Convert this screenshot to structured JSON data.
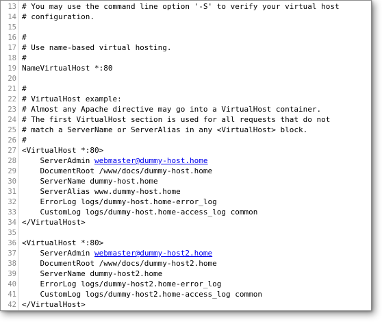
{
  "editor": {
    "lines": [
      {
        "num": "13",
        "pre": "# You may use the command line option '-S' to verify your virtual host",
        "link": "",
        "post": ""
      },
      {
        "num": "14",
        "pre": "# configuration.",
        "link": "",
        "post": ""
      },
      {
        "num": "15",
        "pre": "",
        "link": "",
        "post": ""
      },
      {
        "num": "16",
        "pre": "#",
        "link": "",
        "post": ""
      },
      {
        "num": "17",
        "pre": "# Use name-based virtual hosting.",
        "link": "",
        "post": ""
      },
      {
        "num": "18",
        "pre": "#",
        "link": "",
        "post": ""
      },
      {
        "num": "19",
        "pre": "NameVirtualHost *:80",
        "link": "",
        "post": ""
      },
      {
        "num": "20",
        "pre": "",
        "link": "",
        "post": ""
      },
      {
        "num": "21",
        "pre": "#",
        "link": "",
        "post": ""
      },
      {
        "num": "22",
        "pre": "# VirtualHost example:",
        "link": "",
        "post": ""
      },
      {
        "num": "23",
        "pre": "# Almost any Apache directive may go into a VirtualHost container.",
        "link": "",
        "post": ""
      },
      {
        "num": "24",
        "pre": "# The first VirtualHost section is used for all requests that do not",
        "link": "",
        "post": ""
      },
      {
        "num": "25",
        "pre": "# match a ServerName or ServerAlias in any <VirtualHost> block.",
        "link": "",
        "post": ""
      },
      {
        "num": "26",
        "pre": "#",
        "link": "",
        "post": ""
      },
      {
        "num": "27",
        "pre": "<VirtualHost *:80>",
        "link": "",
        "post": ""
      },
      {
        "num": "28",
        "pre": "    ServerAdmin ",
        "link": "webmaster@dummy-host.home",
        "post": ""
      },
      {
        "num": "29",
        "pre": "    DocumentRoot /www/docs/dummy-host.home",
        "link": "",
        "post": ""
      },
      {
        "num": "30",
        "pre": "    ServerName dummy-host.home",
        "link": "",
        "post": ""
      },
      {
        "num": "31",
        "pre": "    ServerAlias www.dummy-host.home",
        "link": "",
        "post": ""
      },
      {
        "num": "32",
        "pre": "    ErrorLog logs/dummy-host.home-error_log",
        "link": "",
        "post": ""
      },
      {
        "num": "33",
        "pre": "    CustomLog logs/dummy-host.home-access_log common",
        "link": "",
        "post": ""
      },
      {
        "num": "34",
        "pre": "</VirtualHost>",
        "link": "",
        "post": ""
      },
      {
        "num": "35",
        "pre": "",
        "link": "",
        "post": ""
      },
      {
        "num": "36",
        "pre": "<VirtualHost *:80>",
        "link": "",
        "post": ""
      },
      {
        "num": "37",
        "pre": "    ServerAdmin ",
        "link": "webmaster@dummy-host2.home",
        "post": ""
      },
      {
        "num": "38",
        "pre": "    DocumentRoot /www/docs/dummy-host2.home",
        "link": "",
        "post": ""
      },
      {
        "num": "39",
        "pre": "    ServerName dummy-host2.home",
        "link": "",
        "post": ""
      },
      {
        "num": "40",
        "pre": "    ErrorLog logs/dummy-host2.home-error_log",
        "link": "",
        "post": ""
      },
      {
        "num": "41",
        "pre": "    CustomLog logs/dummy-host2.home-access_log common",
        "link": "",
        "post": ""
      },
      {
        "num": "42",
        "pre": "</VirtualHost>",
        "link": "",
        "post": ""
      }
    ]
  },
  "colors": {
    "link": "#0000ee",
    "line_number": "#8a8a8a",
    "text": "#000000"
  }
}
